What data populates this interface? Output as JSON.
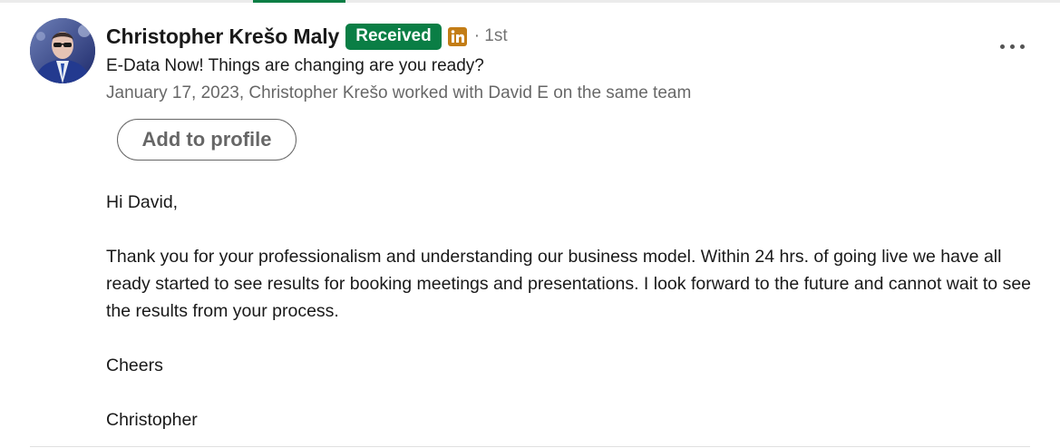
{
  "recommendation": {
    "author_name": "Christopher Krešo Maly",
    "status_badge": "Received",
    "degree": "· 1st",
    "headline": "E-Data Now! Things are changing are you ready?",
    "meta": "January 17, 2023, Christopher Krešo worked with David E on the same team",
    "add_to_profile_label": "Add to profile",
    "body": {
      "greeting": "Hi David,",
      "main": "Thank you for your professionalism and understanding our business model. Within 24 hrs. of going live we have all ready started to see results for booking meetings and presentations. I look forward to the future and cannot wait to see the results from your process.",
      "closing": "Cheers",
      "signature": "Christopher"
    }
  },
  "icons": {
    "premium": "linkedin-premium-icon",
    "more": "more-options-icon"
  },
  "colors": {
    "badge_green": "#0a7e45",
    "premium_gold": "#c37d16"
  }
}
